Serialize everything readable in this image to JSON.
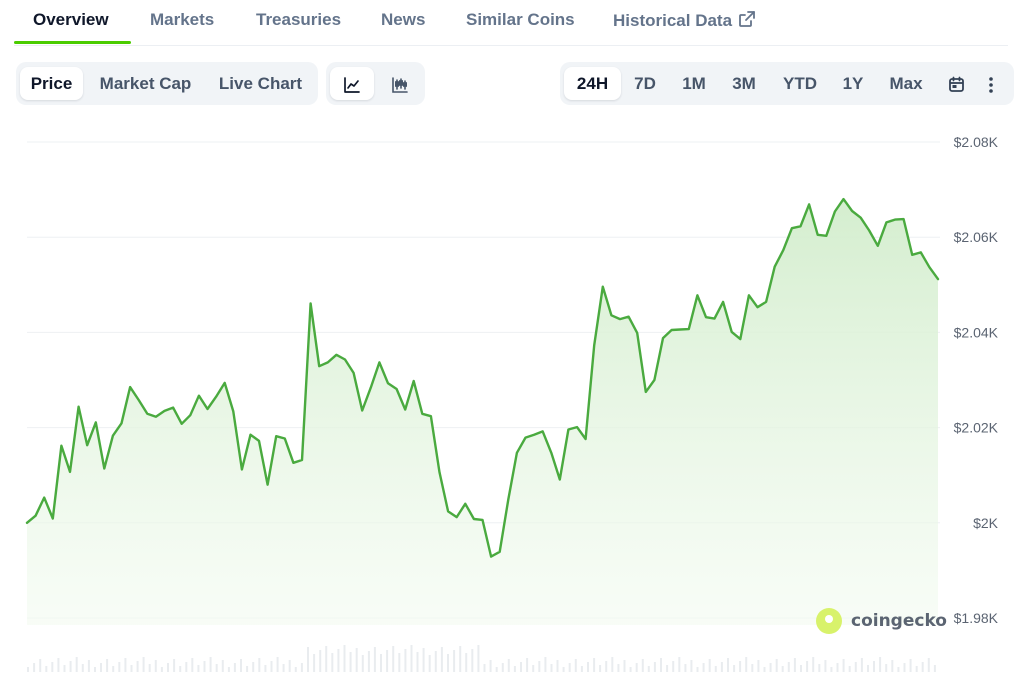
{
  "tabs": [
    {
      "label": "Overview",
      "active": true
    },
    {
      "label": "Markets"
    },
    {
      "label": "Treasuries"
    },
    {
      "label": "News"
    },
    {
      "label": "Similar Coins"
    },
    {
      "label": "Historical Data",
      "icon": "external-link-icon"
    }
  ],
  "chart_types": [
    {
      "label": "Price",
      "active": true
    },
    {
      "label": "Market Cap"
    },
    {
      "label": "Live Chart"
    }
  ],
  "view_modes": [
    {
      "icon": "line-chart-icon",
      "active": true
    },
    {
      "icon": "candlestick-chart-icon"
    }
  ],
  "ranges": [
    {
      "label": "24H",
      "active": true
    },
    {
      "label": "7D"
    },
    {
      "label": "1M"
    },
    {
      "label": "3M"
    },
    {
      "label": "YTD"
    },
    {
      "label": "1Y"
    },
    {
      "label": "Max"
    }
  ],
  "range_icons": [
    "calendar-icon",
    "more-vertical-icon"
  ],
  "brand": {
    "name": "coingecko",
    "logo": "coingecko-logo"
  },
  "colors": {
    "accent": "#4bcc00",
    "line": "#4aaa3f",
    "fill": "#e3f4df"
  },
  "chart_data": {
    "type": "area",
    "title": "",
    "xlabel": "",
    "ylabel": "",
    "ylim": [
      1.98,
      2.08
    ],
    "y_ticks": [
      "$2.08K",
      "$2.06K",
      "$2.04K",
      "$2.02K",
      "$2K",
      "$1.98K"
    ],
    "y_tick_values": [
      2.08,
      2.06,
      2.04,
      2.02,
      2.0,
      1.98
    ],
    "grid": true,
    "series": [
      {
        "values": [
          2.0,
          2.0015,
          2.0053,
          2.0009,
          2.0162,
          2.0107,
          2.0244,
          2.0163,
          2.0211,
          2.0114,
          2.0183,
          2.0209,
          2.0285,
          2.0258,
          2.0229,
          2.0223,
          2.0235,
          2.0242,
          2.0208,
          2.0226,
          2.0267,
          2.0239,
          2.0265,
          2.0294,
          2.0234,
          2.0112,
          2.0185,
          2.0172,
          2.008,
          2.0182,
          2.0177,
          2.0126,
          2.0132,
          2.0461,
          2.0329,
          2.0337,
          2.0353,
          2.0343,
          2.0315,
          2.0236,
          2.0284,
          2.0337,
          2.0293,
          2.0281,
          2.0238,
          2.0298,
          2.0229,
          2.0224,
          2.0106,
          2.0024,
          2.0012,
          2.004,
          2.0008,
          2.0006,
          1.9929,
          1.9939,
          2.0049,
          2.0147,
          2.0179,
          2.0185,
          2.0192,
          2.0147,
          2.0091,
          2.0196,
          2.0201,
          2.0176,
          2.0373,
          2.0496,
          2.0436,
          2.0428,
          2.0433,
          2.0399,
          2.0275,
          2.03,
          2.0388,
          2.0405,
          2.0406,
          2.0407,
          2.0478,
          2.0432,
          2.0429,
          2.0464,
          2.0401,
          2.0386,
          2.0478,
          2.0453,
          2.0464,
          2.0538,
          2.0573,
          2.0619,
          2.0623,
          2.0669,
          2.0605,
          2.0603,
          2.0654,
          2.068,
          2.0655,
          2.0641,
          2.0614,
          2.0582,
          2.0631,
          2.0637,
          2.0638,
          2.0563,
          2.0568,
          2.0537,
          2.0512
        ]
      }
    ]
  }
}
